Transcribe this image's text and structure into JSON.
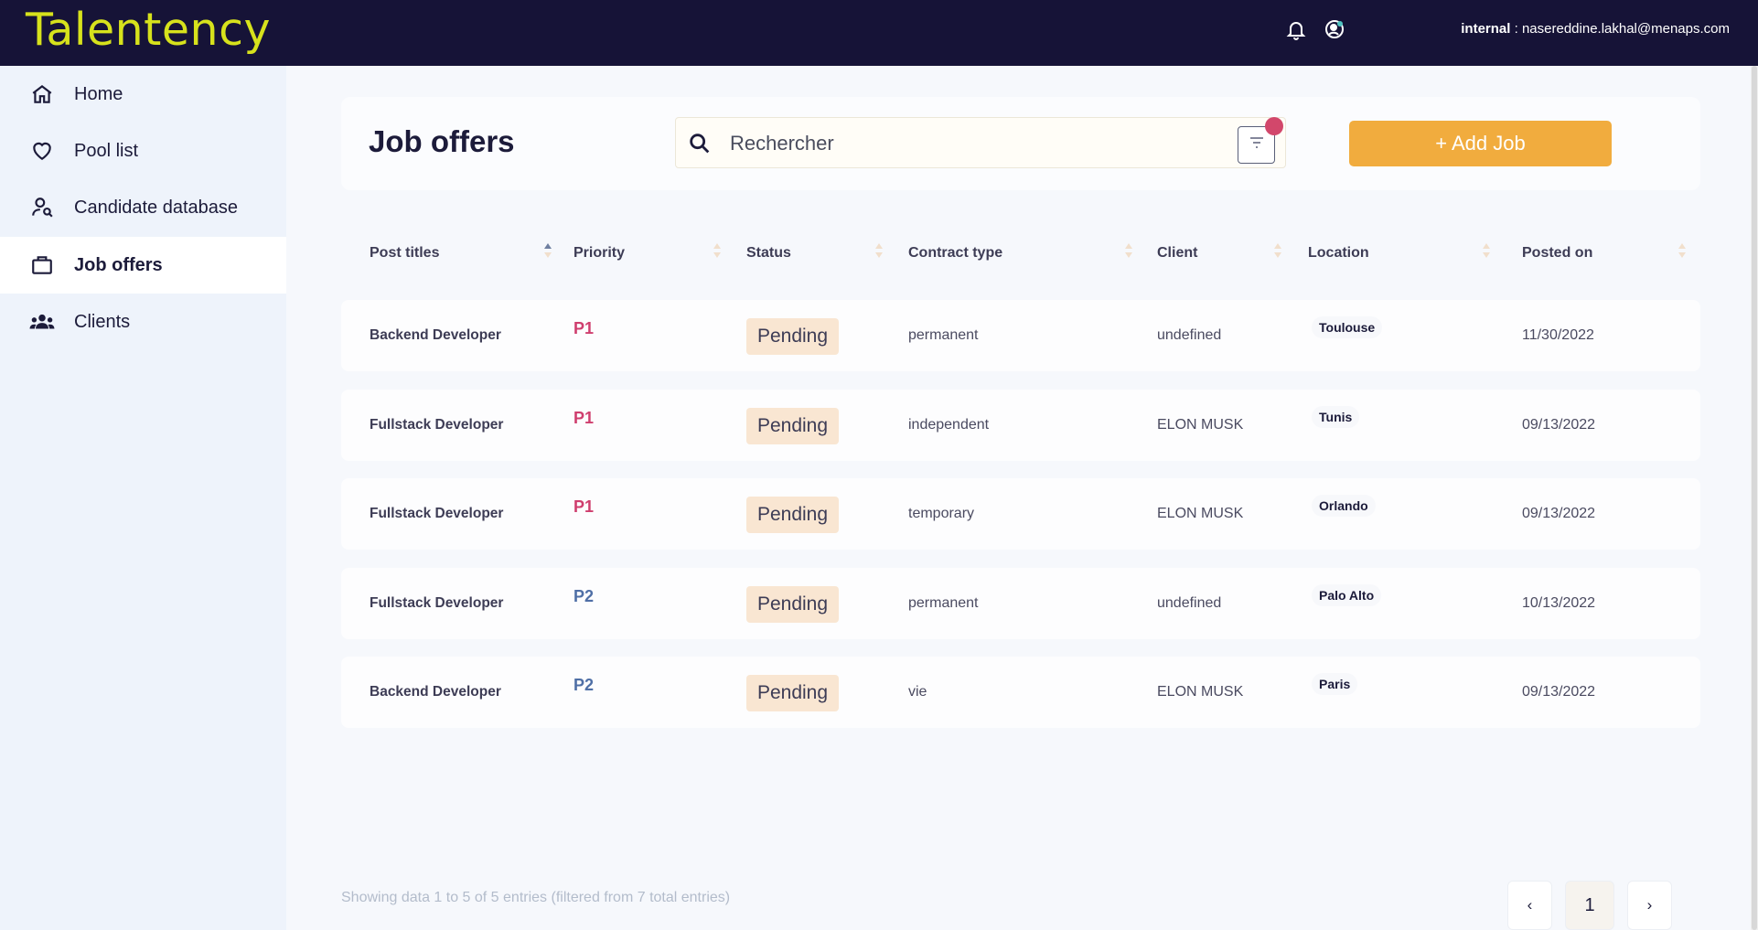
{
  "app": {
    "brand": "Talentency",
    "user_role": "internal",
    "user_separator": " : ",
    "user_email": "nasereddine.lakhal@menaps.com"
  },
  "sidebar": {
    "items": [
      {
        "label": "Home",
        "icon": "home-icon",
        "active": false
      },
      {
        "label": "Pool list",
        "icon": "heart-icon",
        "active": false
      },
      {
        "label": "Candidate database",
        "icon": "user-search-icon",
        "active": false
      },
      {
        "label": "Job offers",
        "icon": "briefcase-icon",
        "active": true
      },
      {
        "label": "Clients",
        "icon": "group-icon",
        "active": false
      }
    ]
  },
  "main": {
    "title": "Job offers",
    "search": {
      "placeholder": "Rechercher",
      "value": ""
    },
    "add_button": "+ Add Job",
    "columns": [
      "Post titles",
      "Priority",
      "Status",
      "Contract type",
      "Client",
      "Location",
      "Posted on"
    ],
    "rows": [
      {
        "title": "Backend Developer",
        "priority": "P1",
        "status": "Pending",
        "contract": "permanent",
        "client": "undefined",
        "location": "Toulouse",
        "posted": "11/30/2022"
      },
      {
        "title": "Fullstack Developer",
        "priority": "P1",
        "status": "Pending",
        "contract": "independent",
        "client": "ELON MUSK",
        "location": "Tunis",
        "posted": "09/13/2022"
      },
      {
        "title": "Fullstack Developer",
        "priority": "P1",
        "status": "Pending",
        "contract": "temporary",
        "client": "ELON MUSK",
        "location": "Orlando",
        "posted": "09/13/2022"
      },
      {
        "title": "Fullstack Developer",
        "priority": "P2",
        "status": "Pending",
        "contract": "permanent",
        "client": "undefined",
        "location": "Palo Alto",
        "posted": "10/13/2022"
      },
      {
        "title": "Backend Developer",
        "priority": "P2",
        "status": "Pending",
        "contract": "vie",
        "client": "ELON MUSK",
        "location": "Paris",
        "posted": "09/13/2022"
      }
    ],
    "showing": "Showing data 1 to 5 of 5 entries (filtered from 7 total entries)",
    "pagination": {
      "prev": "‹",
      "current": "1",
      "next": "›"
    }
  },
  "colors": {
    "header_bg": "#161337",
    "brand": "#d7e21c",
    "accent_orange": "#f1ac3e",
    "priority_p1": "#cf3e6e",
    "priority_p2": "#4f6fa6",
    "status_bg": "#f9e6d2",
    "filter_dot": "#d2476b"
  }
}
